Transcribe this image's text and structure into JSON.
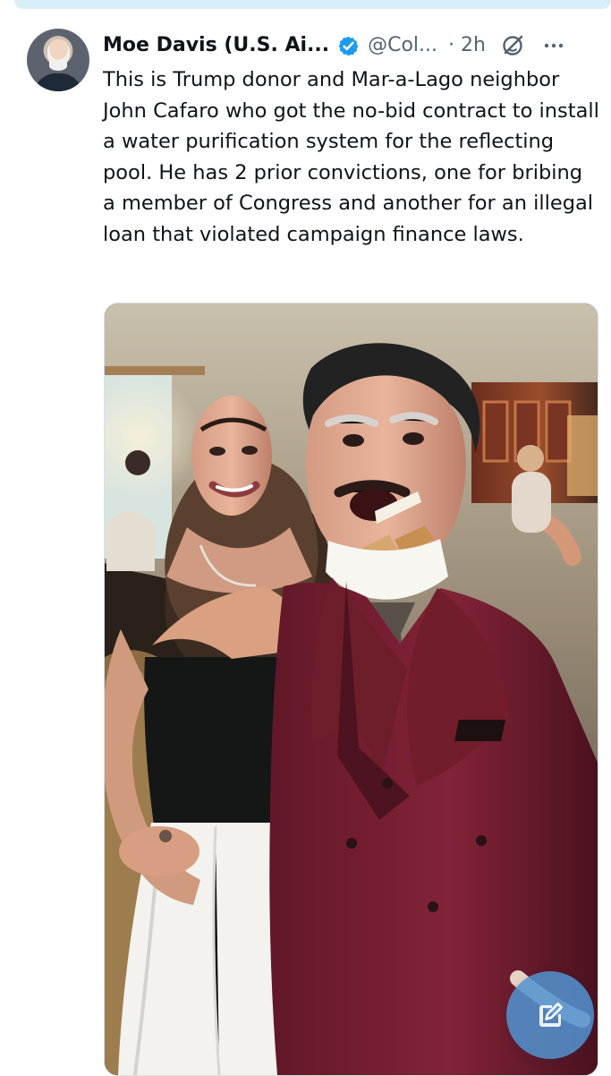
{
  "tweet": {
    "display_name": "Moe Davis (U.S. Ai...",
    "handle": "@Col...",
    "time": "· 2h",
    "text": "This is Trump donor and Mar-a-Lago neighbor John Cafaro who got the no-bid contract to install a water purification system for the reflecting pool. He has 2 prior convictions, one for bribing a member of Congress and another for an illegal loan that violated campaign finance laws."
  },
  "icons": {
    "verified": "verified-badge-icon",
    "grok": "grok-icon",
    "more": "more-options-icon",
    "compose": "compose-post-icon"
  },
  "colors": {
    "verified": "#1d9bf0",
    "secondary_text": "#536471",
    "compose_button": "#5093d1"
  }
}
